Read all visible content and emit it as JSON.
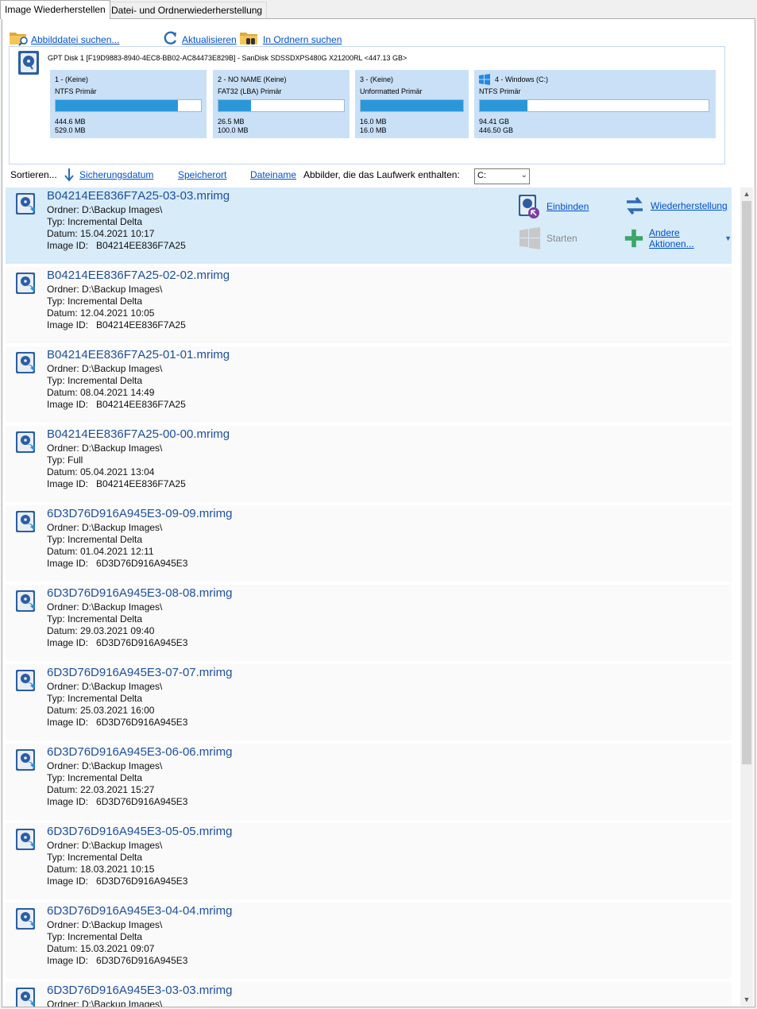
{
  "tabs": [
    "Image Wiederherstellen",
    "Datei- und Ordnerwiederherstellung"
  ],
  "toolbar": {
    "browse_label": "Abbilddatei suchen...",
    "refresh_label": "Aktualisieren",
    "folders_label": "In Ordnern suchen"
  },
  "disk": {
    "title": "GPT Disk 1 [F19D9883-8940-4EC8-BB02-AC84473E829B] - SanDisk SDSSDXPS480G X21200RL  <447.13 GB>",
    "partitions": [
      {
        "label": "1 -  (Keine)",
        "type": "NTFS Primär",
        "used": "444.6 MB",
        "total": "529.0 MB",
        "fill": 0.84
      },
      {
        "label": "2 - NO NAME (Keine)",
        "type": "FAT32 (LBA) Primär",
        "used": "26.5 MB",
        "total": "100.0 MB",
        "fill": 0.26
      },
      {
        "label": "3 -  (Keine)",
        "type": "Unformatted Primär",
        "used": "16.0 MB",
        "total": "16.0 MB",
        "fill": 1.0
      },
      {
        "label": "4 - Windows (C:)",
        "type": "NTFS Primär",
        "used": "94.41 GB",
        "total": "446.50 GB",
        "fill": 0.21
      }
    ]
  },
  "sort": {
    "label": "Sortieren...",
    "by_date": "Sicherungsdatum",
    "by_location": "Speicherort",
    "by_name": "Dateiname",
    "filter_label": "Abbilder, die das Laufwerk enthalten:",
    "filter_value": "C:"
  },
  "actions": {
    "mount": "Einbinden",
    "restore": "Wiederherstellung",
    "start": "Starten",
    "other": "Andere Aktionen..."
  },
  "labels": {
    "folder": "Ordner:",
    "type": "Typ:",
    "date": "Datum:",
    "image_id": "Image ID:"
  },
  "images": [
    {
      "name": "B04214EE836F7A25-03-03.mrimg",
      "folder": "D:\\Backup Images\\",
      "type": "Incremental Delta",
      "date": "15.04.2021 10:17",
      "id": "B04214EE836F7A25"
    },
    {
      "name": "B04214EE836F7A25-02-02.mrimg",
      "folder": "D:\\Backup Images\\",
      "type": "Incremental Delta",
      "date": "12.04.2021 10:05",
      "id": "B04214EE836F7A25"
    },
    {
      "name": "B04214EE836F7A25-01-01.mrimg",
      "folder": "D:\\Backup Images\\",
      "type": "Incremental Delta",
      "date": "08.04.2021 14:49",
      "id": "B04214EE836F7A25"
    },
    {
      "name": "B04214EE836F7A25-00-00.mrimg",
      "folder": "D:\\Backup Images\\",
      "type": "Full",
      "date": "05.04.2021 13:04",
      "id": "B04214EE836F7A25"
    },
    {
      "name": "6D3D76D916A945E3-09-09.mrimg",
      "folder": "D:\\Backup Images\\",
      "type": "Incremental Delta",
      "date": "01.04.2021 12:11",
      "id": "6D3D76D916A945E3"
    },
    {
      "name": "6D3D76D916A945E3-08-08.mrimg",
      "folder": "D:\\Backup Images\\",
      "type": "Incremental Delta",
      "date": "29.03.2021 09:40",
      "id": "6D3D76D916A945E3"
    },
    {
      "name": "6D3D76D916A945E3-07-07.mrimg",
      "folder": "D:\\Backup Images\\",
      "type": "Incremental Delta",
      "date": "25.03.2021 16:00",
      "id": "6D3D76D916A945E3"
    },
    {
      "name": "6D3D76D916A945E3-06-06.mrimg",
      "folder": "D:\\Backup Images\\",
      "type": "Incremental Delta",
      "date": "22.03.2021 15:27",
      "id": "6D3D76D916A945E3"
    },
    {
      "name": "6D3D76D916A945E3-05-05.mrimg",
      "folder": "D:\\Backup Images\\",
      "type": "Incremental Delta",
      "date": "18.03.2021 10:15",
      "id": "6D3D76D916A945E3"
    },
    {
      "name": "6D3D76D916A945E3-04-04.mrimg",
      "folder": "D:\\Backup Images\\",
      "type": "Incremental Delta",
      "date": "15.03.2021 09:07",
      "id": "6D3D76D916A945E3"
    },
    {
      "name": "6D3D76D916A945E3-03-03.mrimg",
      "folder": "D:\\Backup Images\\",
      "type": "",
      "date": "",
      "id": ""
    }
  ]
}
